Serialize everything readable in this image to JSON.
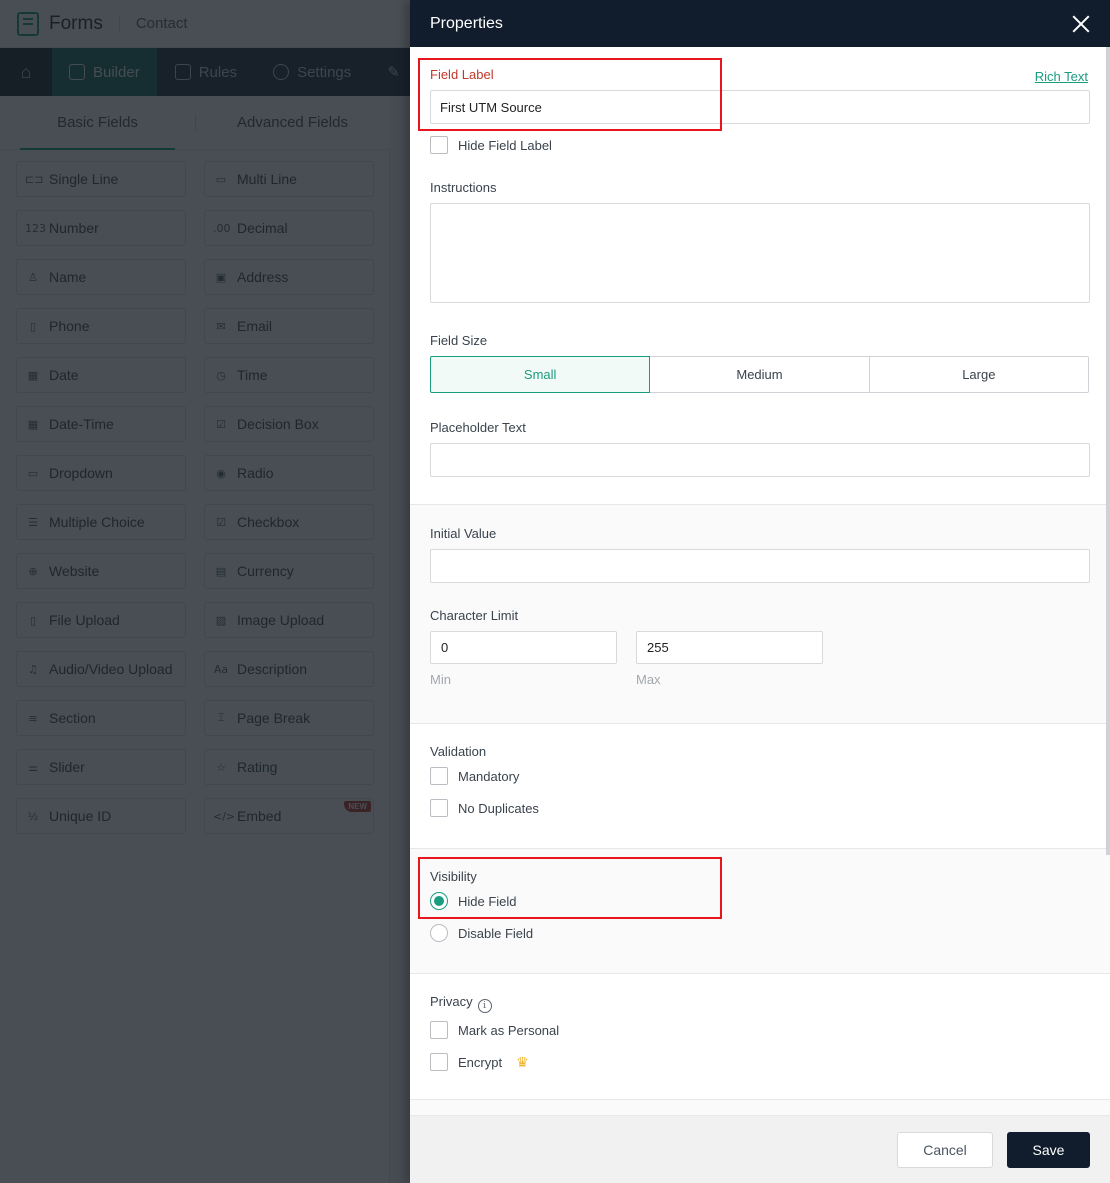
{
  "app": {
    "title": "Forms",
    "form_name": "Contact",
    "nav": [
      {
        "label": "",
        "icon": "home-icon"
      },
      {
        "label": "Builder",
        "icon": "builder-icon",
        "active": true
      },
      {
        "label": "Rules",
        "icon": "rules-icon"
      },
      {
        "label": "Settings",
        "icon": "gear-icon"
      },
      {
        "label": "",
        "icon": "theme-icon"
      }
    ],
    "tabs": [
      {
        "label": "Basic Fields",
        "active": true
      },
      {
        "label": "Advanced Fields",
        "active": false
      }
    ],
    "fields": [
      {
        "label": "Single Line",
        "icon": "single-line-icon",
        "glyph": "⊏⊐"
      },
      {
        "label": "Multi Line",
        "icon": "multi-line-icon",
        "glyph": "▭"
      },
      {
        "label": "Number",
        "icon": "number-icon",
        "glyph": "123"
      },
      {
        "label": "Decimal",
        "icon": "decimal-icon",
        "glyph": ".00"
      },
      {
        "label": "Name",
        "icon": "person-icon",
        "glyph": "♙"
      },
      {
        "label": "Address",
        "icon": "address-book-icon",
        "glyph": "▣"
      },
      {
        "label": "Phone",
        "icon": "phone-icon",
        "glyph": "▯"
      },
      {
        "label": "Email",
        "icon": "envelope-icon",
        "glyph": "✉"
      },
      {
        "label": "Date",
        "icon": "calendar-icon",
        "glyph": "▦"
      },
      {
        "label": "Time",
        "icon": "clock-icon",
        "glyph": "◷"
      },
      {
        "label": "Date-Time",
        "icon": "calendar-clock-icon",
        "glyph": "▦"
      },
      {
        "label": "Decision Box",
        "icon": "checked-box-icon",
        "glyph": "☑"
      },
      {
        "label": "Dropdown",
        "icon": "dropdown-icon",
        "glyph": "▭"
      },
      {
        "label": "Radio",
        "icon": "radio-icon",
        "glyph": "◉"
      },
      {
        "label": "Multiple Choice",
        "icon": "multiple-choice-icon",
        "glyph": "☰"
      },
      {
        "label": "Checkbox",
        "icon": "checkbox-list-icon",
        "glyph": "☑"
      },
      {
        "label": "Website",
        "icon": "globe-icon",
        "glyph": "⊕"
      },
      {
        "label": "Currency",
        "icon": "currency-icon",
        "glyph": "▤"
      },
      {
        "label": "File Upload",
        "icon": "file-upload-icon",
        "glyph": "▯"
      },
      {
        "label": "Image Upload",
        "icon": "image-upload-icon",
        "glyph": "▨"
      },
      {
        "label": "Audio/Video Upload",
        "icon": "media-upload-icon",
        "glyph": "♫"
      },
      {
        "label": "Description",
        "icon": "text-aa-icon",
        "glyph": "Aa"
      },
      {
        "label": "Section",
        "icon": "section-icon",
        "glyph": "≡"
      },
      {
        "label": "Page Break",
        "icon": "page-break-icon",
        "glyph": "⌶"
      },
      {
        "label": "Slider",
        "icon": "slider-icon",
        "glyph": "⚌"
      },
      {
        "label": "Rating",
        "icon": "star-icon",
        "glyph": "☆"
      },
      {
        "label": "Unique ID",
        "icon": "unique-id-icon",
        "glyph": "½"
      },
      {
        "label": "Embed",
        "icon": "code-icon",
        "glyph": "</>",
        "badge": "NEW"
      }
    ]
  },
  "properties": {
    "title": "Properties",
    "field_label": {
      "label": "Field Label",
      "rich_text_link": "Rich Text",
      "value": "First UTM Source",
      "hide_label": "Hide Field Label",
      "hide_label_checked": false
    },
    "instructions": {
      "label": "Instructions",
      "value": ""
    },
    "field_size": {
      "label": "Field Size",
      "options": [
        "Small",
        "Medium",
        "Large"
      ],
      "selected": "Small"
    },
    "placeholder": {
      "label": "Placeholder Text",
      "value": ""
    },
    "initial_value": {
      "label": "Initial Value",
      "value": ""
    },
    "character_limit": {
      "label": "Character Limit",
      "min_value": "0",
      "max_value": "255",
      "min_label": "Min",
      "max_label": "Max"
    },
    "validation": {
      "label": "Validation",
      "options": [
        {
          "label": "Mandatory",
          "checked": false
        },
        {
          "label": "No Duplicates",
          "checked": false
        }
      ]
    },
    "visibility": {
      "label": "Visibility",
      "options": [
        {
          "label": "Hide Field",
          "selected": true
        },
        {
          "label": "Disable Field",
          "selected": false
        }
      ]
    },
    "privacy": {
      "label": "Privacy",
      "options": [
        {
          "label": "Mark as Personal",
          "checked": false
        },
        {
          "label": "Encrypt",
          "checked": false,
          "premium": true
        }
      ]
    },
    "footer": {
      "cancel": "Cancel",
      "save": "Save"
    }
  },
  "colors": {
    "accent": "#1a9c7f",
    "header_dark": "#111c2c",
    "highlight_red": "#e8141e",
    "label_red": "#c0392b"
  }
}
